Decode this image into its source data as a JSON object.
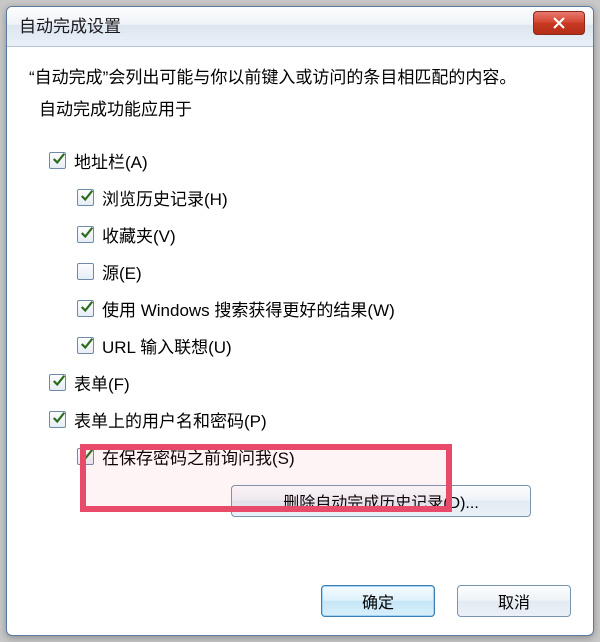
{
  "dialog": {
    "title": "自动完成设置",
    "description": "“自动完成”会列出可能与你以前键入或访问的条目相匹配的内容。",
    "sub_heading": "自动完成功能应用于",
    "checkboxes": {
      "address_bar": {
        "label": "地址栏(A)",
        "checked": true
      },
      "history": {
        "label": "浏览历史记录(H)",
        "checked": true
      },
      "favorites": {
        "label": "收藏夹(V)",
        "checked": true
      },
      "feeds": {
        "label": "源(E)",
        "checked": false
      },
      "windows_search": {
        "label": "使用 Windows 搜索获得更好的结果(W)",
        "checked": true
      },
      "url_suggest": {
        "label": "URL 输入联想(U)",
        "checked": true
      },
      "forms": {
        "label": "表单(F)",
        "checked": true
      },
      "form_passwords": {
        "label": "表单上的用户名和密码(P)",
        "checked": true
      },
      "ask_before_save": {
        "label": "在保存密码之前询问我(S)",
        "checked": true
      }
    },
    "delete_history_button": "删除自动完成历史记录(D)...",
    "ok_button": "确定",
    "cancel_button": "取消"
  }
}
